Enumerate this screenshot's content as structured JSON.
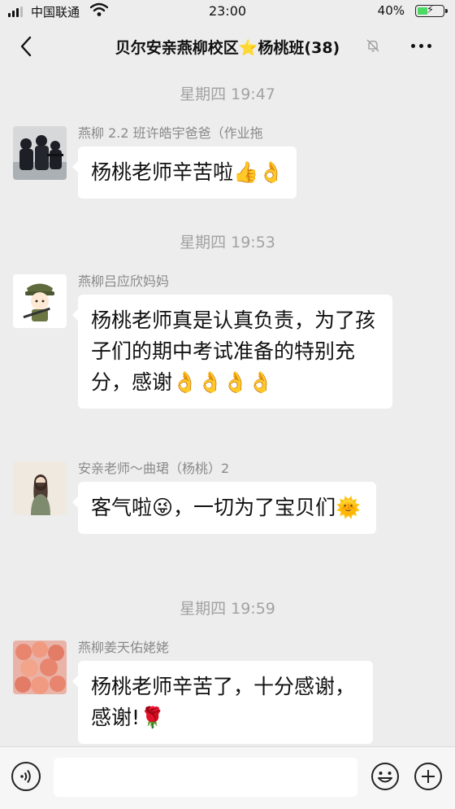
{
  "status_bar": {
    "carrier": "中国联通",
    "time": "23:00",
    "battery_percent": "40%",
    "battery_level": 0.4
  },
  "nav": {
    "title": "贝尔安亲燕柳校区⭐杨桃班(38)",
    "back_icon": "chevron-left-icon",
    "mute_icon": "bell-off-icon",
    "more_icon": "more-dots-icon"
  },
  "chat": {
    "time_labels": [
      "星期四 19:47",
      "星期四 19:53",
      "星期四 19:59"
    ],
    "messages": [
      {
        "sender": "燕柳 2.2 班许皓宇爸爸（作业拖",
        "text": "杨桃老师辛苦啦👍👌"
      },
      {
        "sender": "燕柳吕应欣妈妈",
        "text": "杨桃老师真是认真负责，为了孩子们的期中考试准备的特别充分，感谢👌👌👌👌"
      },
      {
        "sender": "安亲老师～曲珺（杨桃）2",
        "text": "客气啦😜，一切为了宝贝们🌞"
      },
      {
        "sender": "燕柳姜天佑姥姥",
        "text": "杨桃老师辛苦了，十分感谢，感谢!🌹"
      }
    ]
  },
  "input_bar": {
    "voice_icon": "voice-icon",
    "emoji_icon": "emoji-icon",
    "plus_icon": "plus-circle-icon",
    "input_value": ""
  },
  "colors": {
    "background": "#ededed",
    "bubble": "#ffffff",
    "timestamp": "#a2a2a2",
    "sender_name": "#8a8a8a"
  }
}
